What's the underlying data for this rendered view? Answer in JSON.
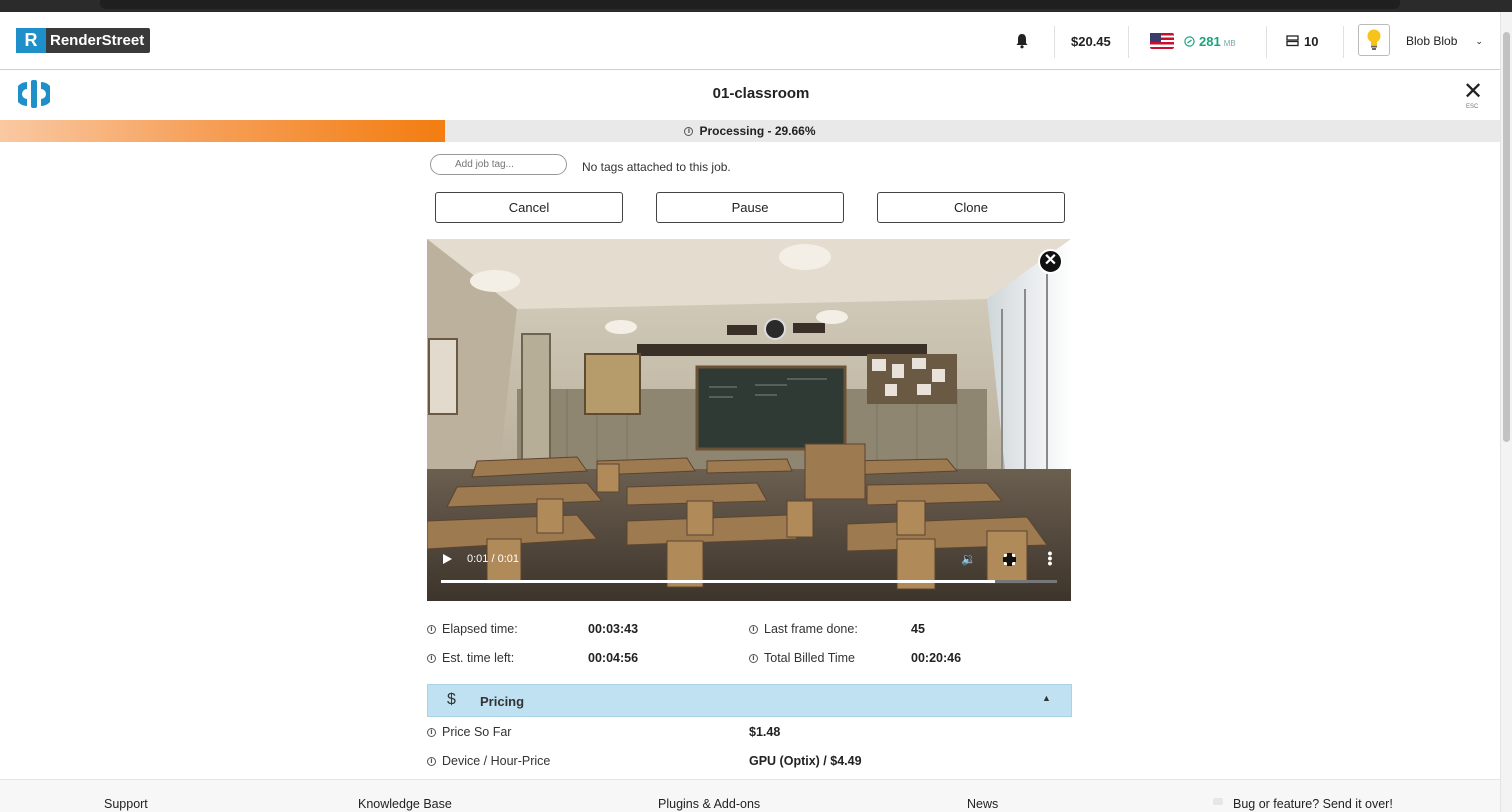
{
  "app": {
    "brand_letter": "R",
    "brand_name": "RenderStreet"
  },
  "topbar": {
    "balance": "$20.45",
    "data_amount": "281",
    "data_unit": "MB",
    "nodes_count": "10",
    "user_name": "Blob Blob"
  },
  "job": {
    "title": "01-classroom",
    "close_hint": "ESC",
    "progress_percent": 29.66,
    "progress_label": "Processing - 29.66%",
    "tag_placeholder": "Add job tag...",
    "tags_note": "No tags attached to this job.",
    "buttons": {
      "cancel": "Cancel",
      "pause": "Pause",
      "clone": "Clone"
    }
  },
  "video": {
    "time": "0:01 / 0:01",
    "progress_fraction": 0.9
  },
  "stats": {
    "elapsed_label": "Elapsed time:",
    "elapsed_value": "00:03:43",
    "est_label": "Est. time left:",
    "est_value": "00:04:56",
    "last_frame_label": "Last frame done:",
    "last_frame_value": "45",
    "billed_label": "Total Billed Time",
    "billed_value": "00:20:46"
  },
  "pricing": {
    "title": "Pricing",
    "price_label": "Price So Far",
    "price_value": "$1.48",
    "device_label": "Device / Hour-Price",
    "device_value": "GPU (Optix) / $4.49"
  },
  "footer": {
    "support": "Support",
    "knowledge_base": "Knowledge Base",
    "plugins": "Plugins & Add-ons",
    "news": "News",
    "bug": "Bug or feature? Send it over!"
  },
  "colors": {
    "brand_blue": "#1f8fc9",
    "progress_orange": "#f37d10",
    "pricing_bg": "#bfe1f2",
    "data_green": "#1aa37a"
  }
}
